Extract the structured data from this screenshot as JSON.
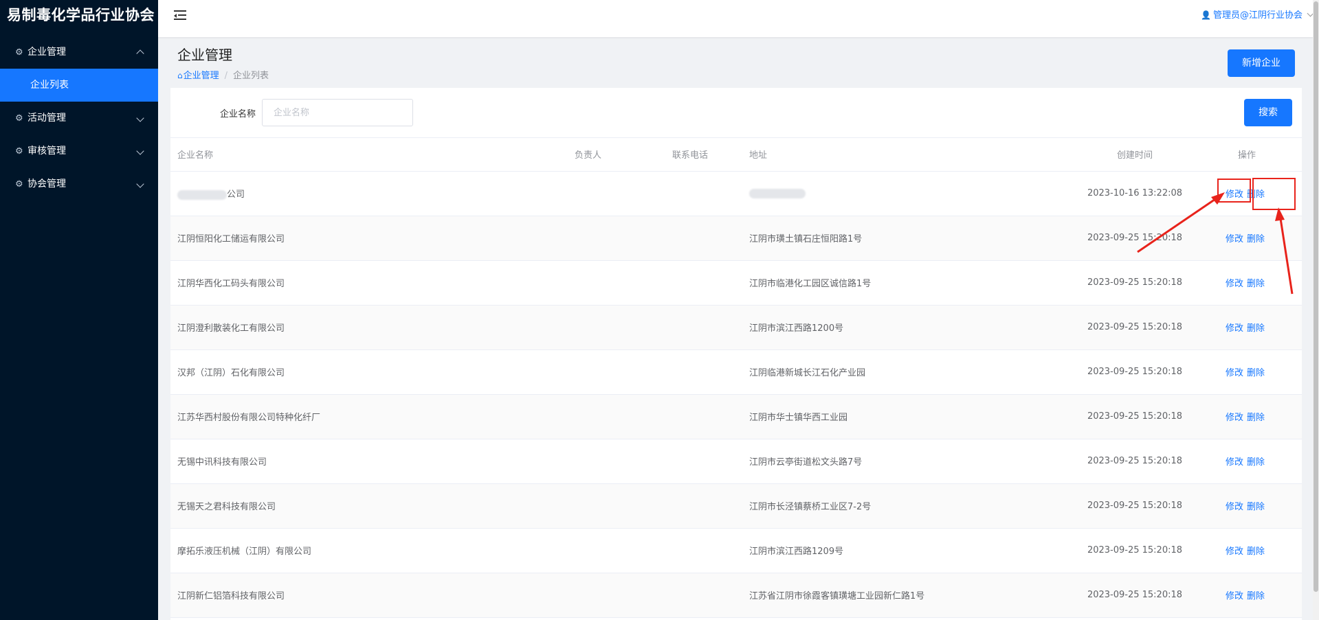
{
  "brand": {
    "title": "易制毒化学品行业协会"
  },
  "sidebar": {
    "items": [
      {
        "label": "企业管理",
        "expanded": true,
        "children": [
          {
            "label": "企业列表",
            "active": true
          }
        ]
      },
      {
        "label": "活动管理",
        "expanded": false
      },
      {
        "label": "审核管理",
        "expanded": false
      },
      {
        "label": "协会管理",
        "expanded": false
      }
    ]
  },
  "topbar": {
    "user_label": "管理员@江阴行业协会"
  },
  "page": {
    "title": "企业管理",
    "breadcrumb": {
      "home": "企业管理",
      "current": "企业列表",
      "separator": "/"
    },
    "add_button": "新增企业"
  },
  "search": {
    "label": "企业名称",
    "placeholder": "企业名称",
    "value": "",
    "button": "搜索"
  },
  "table": {
    "headers": {
      "name": "企业名称",
      "owner": "负责人",
      "phone": "联系电话",
      "address": "地址",
      "created": "创建时间",
      "actions": "操作"
    },
    "action_edit": "修改",
    "action_delete": "删除",
    "rows": [
      {
        "name": "公司",
        "owner": "",
        "phone": "",
        "address": "",
        "created": "2023-10-16 13:22:08",
        "redacted": true
      },
      {
        "name": "江阴恒阳化工储运有限公司",
        "owner": "",
        "phone": "",
        "address": "江阴市璜土镇石庄恒阳路1号",
        "created": "2023-09-25 15:20:18"
      },
      {
        "name": "江阴华西化工码头有限公司",
        "owner": "",
        "phone": "",
        "address": "江阴市临港化工园区诚信路1号",
        "created": "2023-09-25 15:20:18"
      },
      {
        "name": "江阴澄利散装化工有限公司",
        "owner": "",
        "phone": "",
        "address": "江阴市滨江西路1200号",
        "created": "2023-09-25 15:20:18"
      },
      {
        "name": "汉邦（江阴）石化有限公司",
        "owner": "",
        "phone": "",
        "address": "江阴临港新城长江石化产业园",
        "created": "2023-09-25 15:20:18"
      },
      {
        "name": "江苏华西村股份有限公司特种化纤厂",
        "owner": "",
        "phone": "",
        "address": "江阴市华士镇华西工业园",
        "created": "2023-09-25 15:20:18"
      },
      {
        "name": "无锡中讯科技有限公司",
        "owner": "",
        "phone": "",
        "address": "江阴市云亭街道松文头路7号",
        "created": "2023-09-25 15:20:18"
      },
      {
        "name": "无锡天之君科技有限公司",
        "owner": "",
        "phone": "",
        "address": "江阴市长泾镇蔡桥工业区7-2号",
        "created": "2023-09-25 15:20:18"
      },
      {
        "name": "摩拓乐液压机械（江阴）有限公司",
        "owner": "",
        "phone": "",
        "address": "江阴市滨江西路1209号",
        "created": "2023-09-25 15:20:18"
      },
      {
        "name": "江阴新仁铝箔科技有限公司",
        "owner": "",
        "phone": "",
        "address": "江苏省江阴市徐霞客镇璜塘工业园新仁路1号",
        "created": "2023-09-25 15:20:18"
      }
    ]
  },
  "colors": {
    "sidebar_bg": "#001529",
    "accent": "#1677ff",
    "annotation": "#e8231b"
  },
  "icons": {
    "menu": "gear-icon",
    "toggle": "hamburger-icon",
    "user": "user-icon",
    "home": "home-icon"
  }
}
